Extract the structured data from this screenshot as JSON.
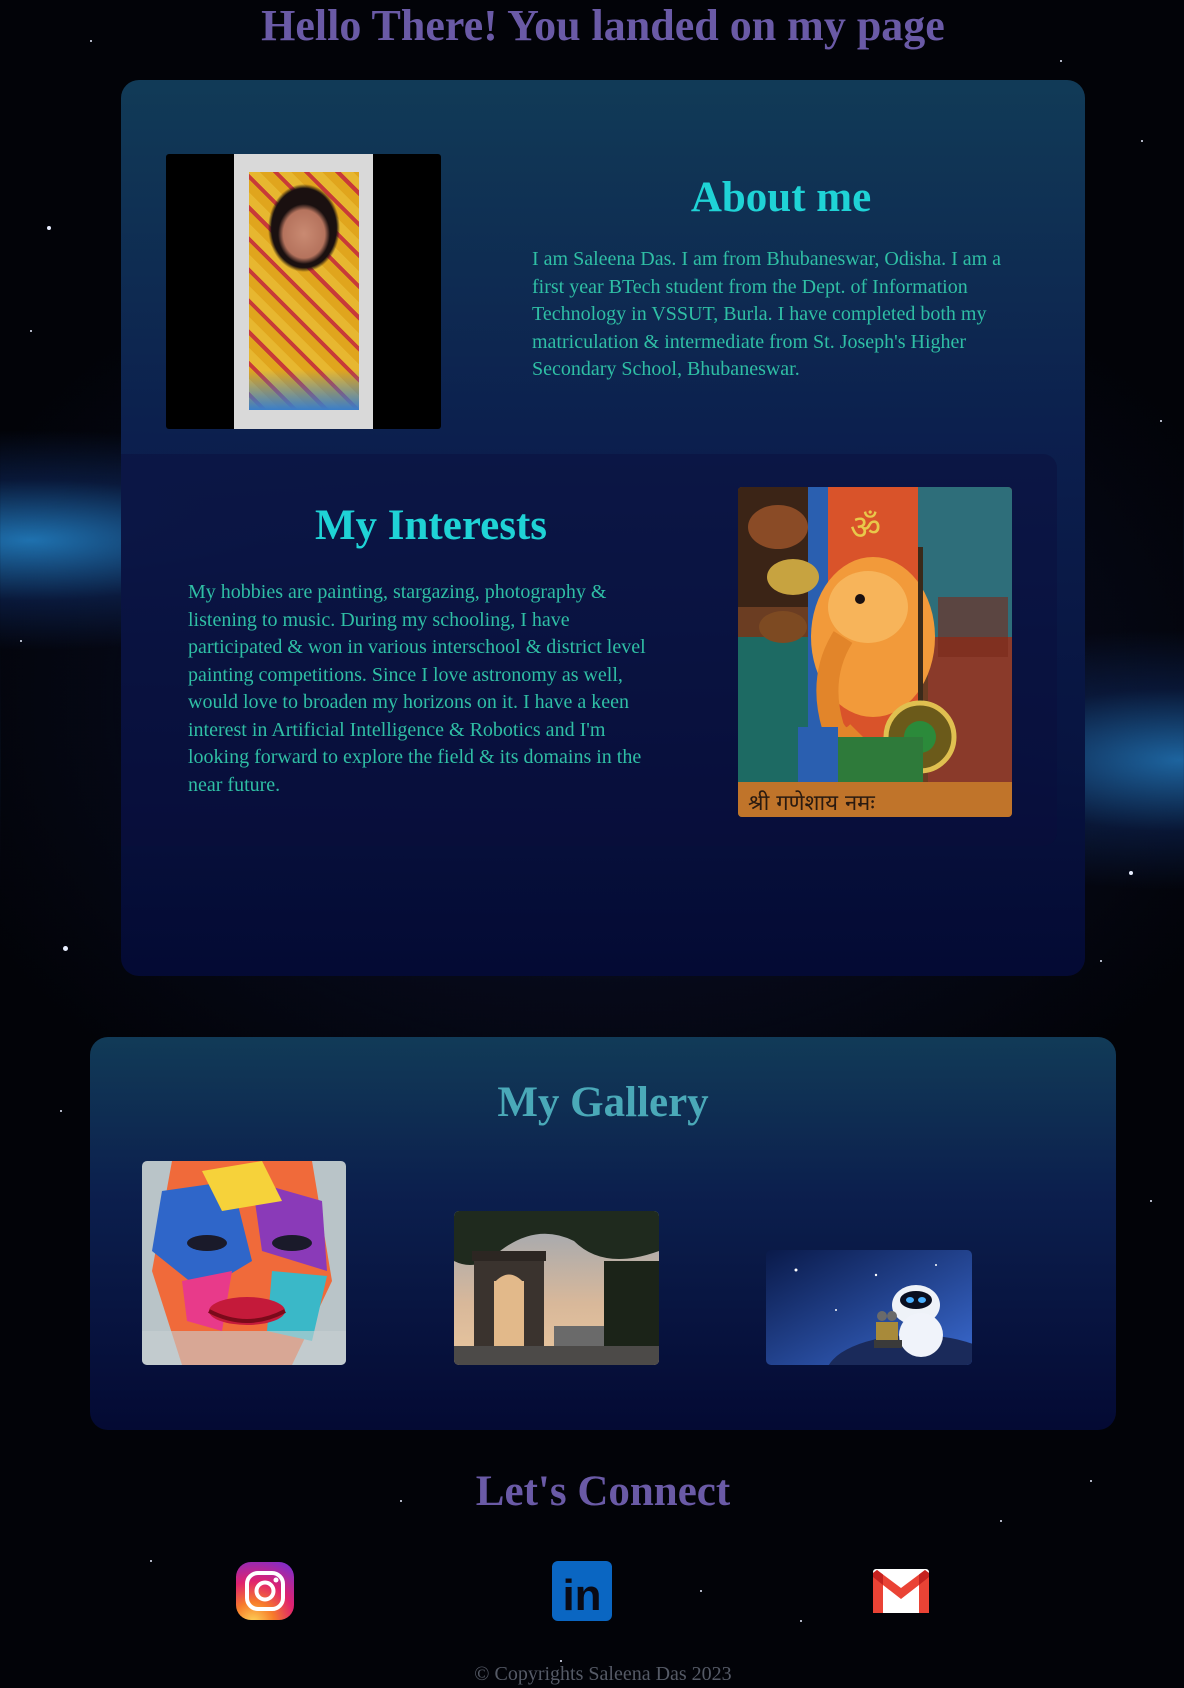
{
  "page_title": "Hello There! You landed on my page",
  "about": {
    "heading": "About me",
    "text": "I am Saleena Das. I am from Bhubaneswar, Odisha. I am a first year BTech student from the Dept. of Information Technology in VSSUT, Burla. I have completed both my matriculation & intermediate from St. Joseph's Higher Secondary School, Bhubaneswar."
  },
  "interests": {
    "heading": "My Interests",
    "text": "My hobbies are painting, stargazing, photography & listening to music. During my schooling, I have participated & won in various interschool & district level painting competitions. Since I love astronomy as well, would love to broaden my horizons on it. I have a keen interest in Artificial Intelligence & Robotics and I'm looking forward to explore the field & its domains in the near future.",
    "painting_caption": "श्री गणेशाय नमः"
  },
  "gallery": {
    "heading": "My Gallery"
  },
  "connect": {
    "heading": "Let's Connect",
    "links": [
      {
        "icon": "instagram-icon"
      },
      {
        "icon": "linkedin-icon",
        "glyph": "in"
      },
      {
        "icon": "gmail-icon"
      }
    ]
  },
  "footer": {
    "copyright": "© Copyrights Saleena Das 2023"
  },
  "colors": {
    "title": "#6a5aa6",
    "heading_cyan": "#1fd3d6",
    "body_text": "#2fbfa5",
    "gallery_heading": "#4aa9b8"
  }
}
